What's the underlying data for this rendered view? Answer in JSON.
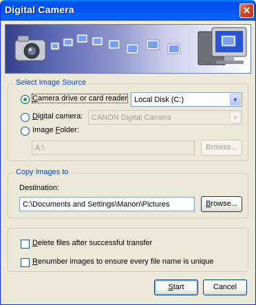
{
  "window": {
    "title": "Digital Camera",
    "close_glyph": "✕"
  },
  "image_source": {
    "legend": "Select Image Source",
    "options": [
      {
        "label_pre": "",
        "label_ul": "C",
        "label_post": "amera drive or card reader",
        "checked": true
      },
      {
        "label_pre": "",
        "label_ul": "D",
        "label_post": "igital camera:",
        "checked": false
      },
      {
        "label_pre": "Image ",
        "label_ul": "F",
        "label_post": "older:",
        "checked": false
      }
    ],
    "drive_select": "Local Disk (C:)",
    "camera_select": "CANON Digital Camera",
    "folder_value": "A:\\",
    "browse_label": "Browse..."
  },
  "copy_to": {
    "legend": "Copy images to",
    "destination_label": "Destination:",
    "destination_value": "C:\\Documents and Settings\\Manon\\Pictures",
    "browse_pre": "",
    "browse_ul": "B",
    "browse_post": "rowse..."
  },
  "options": {
    "delete_ul": "D",
    "delete_post": "elete files after successful transfer",
    "renumber_ul": "R",
    "renumber_post": "enumber images to ensure every file name is unique"
  },
  "buttons": {
    "start_ul": "S",
    "start_post": "tart",
    "cancel": "Cancel"
  },
  "icons": {
    "banner": "camera-to-computer-transfer-icon",
    "close": "close-icon",
    "dropdown": "chevron-down-icon"
  }
}
